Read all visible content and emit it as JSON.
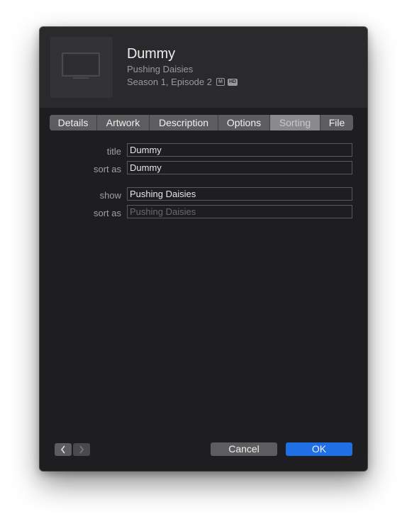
{
  "header": {
    "title": "Dummy",
    "show": "Pushing Daisies",
    "episode": "Season 1, Episode 2",
    "badge_m": "M",
    "badge_hd": "HD",
    "thumbnail_icon": "tv-icon"
  },
  "tabs": [
    {
      "label": "Details"
    },
    {
      "label": "Artwork"
    },
    {
      "label": "Description"
    },
    {
      "label": "Options"
    },
    {
      "label": "Sorting",
      "selected": true
    },
    {
      "label": "File"
    }
  ],
  "sorting": {
    "title_label": "title",
    "title_value": "Dummy",
    "title_sort_label": "sort as",
    "title_sort_value": "Dummy",
    "show_label": "show",
    "show_value": "Pushing Daisies",
    "show_sort_label": "sort as",
    "show_sort_placeholder": "Pushing Daisies"
  },
  "footer": {
    "prev_icon": "chevron-left-icon",
    "next_icon": "chevron-right-icon",
    "cancel_label": "Cancel",
    "ok_label": "OK"
  },
  "colors": {
    "window_bg": "#1e1e20",
    "header_bg": "#2a2a2c",
    "accent": "#1f6fe5",
    "tab_bg": "#5d5d5f",
    "tab_selected_bg": "#8a8a8c"
  }
}
